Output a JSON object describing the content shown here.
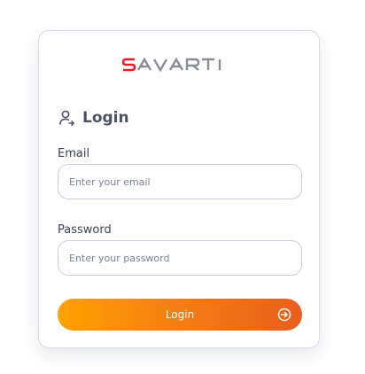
{
  "brand": {
    "logo_text": "SAVARTI",
    "colors": {
      "red": "#e01f2d",
      "gray": "#8a8d96"
    }
  },
  "login": {
    "title": "Login",
    "icon": "user-arrow-icon"
  },
  "form": {
    "email_label": "Email",
    "email_placeholder": "Enter your email",
    "email_value": "",
    "password_label": "Password",
    "password_placeholder": "Enter your password",
    "password_value": "",
    "submit_label": "Login",
    "submit_icon": "arrow-right-circle-icon"
  },
  "theme": {
    "accent_start": "#ffa200",
    "accent_end": "#ea5d1c",
    "border": "#c9cde0"
  }
}
